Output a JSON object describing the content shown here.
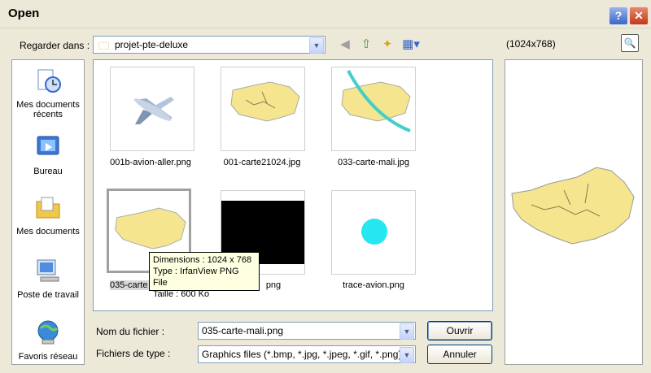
{
  "window": {
    "title": "Open"
  },
  "toolbar": {
    "look_in_label": "Regarder dans :",
    "look_in_value": "projet-pte-deluxe",
    "preview_dims": "(1024x768)"
  },
  "places": [
    {
      "label": "Mes documents récents",
      "icon": "recent-documents-icon"
    },
    {
      "label": "Bureau",
      "icon": "desktop-icon"
    },
    {
      "label": "Mes documents",
      "icon": "my-documents-icon"
    },
    {
      "label": "Poste de travail",
      "icon": "my-computer-icon"
    },
    {
      "label": "Favoris réseau",
      "icon": "network-places-icon"
    }
  ],
  "files": [
    {
      "name": "001b-avion-aller.png",
      "kind": "plane"
    },
    {
      "name": "001-carte21024.jpg",
      "kind": "map"
    },
    {
      "name": "033-carte-mali.jpg",
      "kind": "map-arc"
    },
    {
      "name": "035-carte-mali.png",
      "kind": "map",
      "selected": true,
      "visible_name": "035-carte",
      "visible_suffix": "png"
    },
    {
      "name": "",
      "kind": "black"
    },
    {
      "name": "trace-avion.png",
      "kind": "circle"
    }
  ],
  "tooltip": {
    "line1": "Dimensions : 1024 x 768",
    "line2": "Type : IrfanView PNG File",
    "line3": "Taille  : 600 Ko"
  },
  "form": {
    "filename_label": "Nom du fichier :",
    "filename_value": "035-carte-mali.png",
    "filetype_label": "Fichiers de type :",
    "filetype_value": "Graphics files (*.bmp, *.jpg, *.jpeg, *.gif, *.png)",
    "open_label": "Ouvrir",
    "cancel_label": "Annuler"
  },
  "colors": {
    "map_yellow": "#F5E58E",
    "circle_cyan": "#26E6F0",
    "arc_teal": "#41CFC8"
  }
}
